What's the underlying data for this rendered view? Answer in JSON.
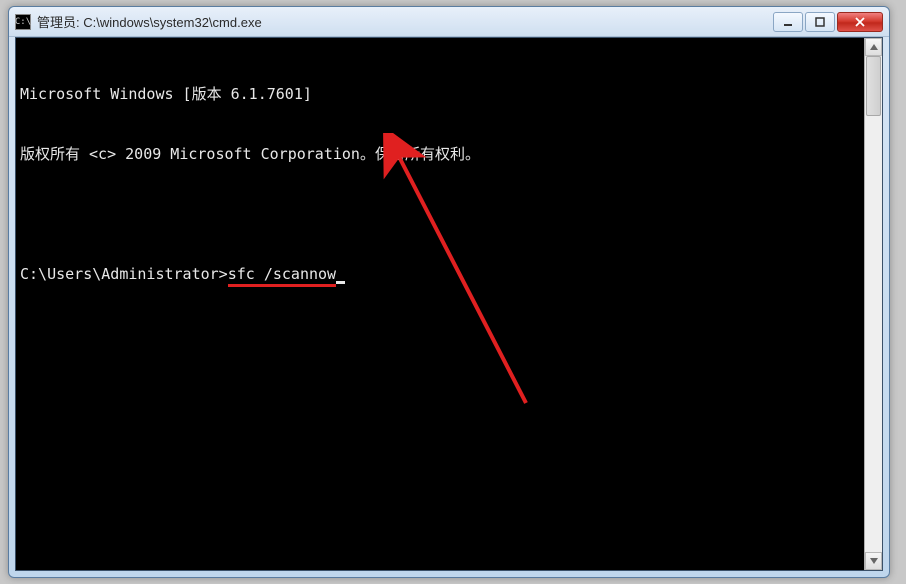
{
  "window": {
    "icon_label": "C:\\",
    "title": "管理员: C:\\windows\\system32\\cmd.exe"
  },
  "terminal": {
    "line1": "Microsoft Windows [版本 6.1.7601]",
    "line2": "版权所有 <c> 2009 Microsoft Corporation。保留所有权利。",
    "prompt": "C:\\Users\\Administrator>",
    "command": "sfc /scannow"
  }
}
